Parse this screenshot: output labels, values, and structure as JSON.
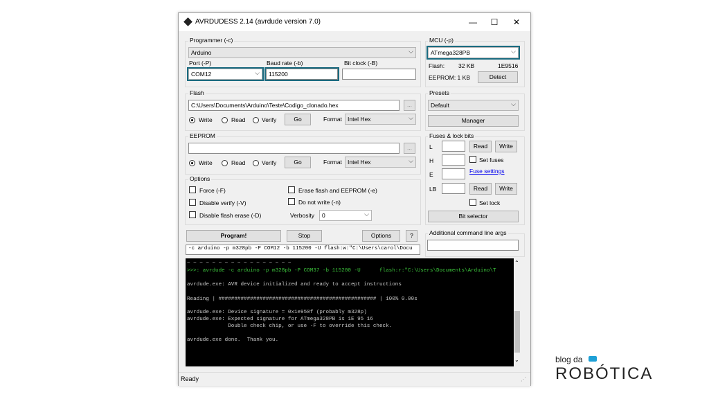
{
  "window": {
    "title": "AVRDUDESS 2.14 (avrdude version 7.0)",
    "minimize": "—",
    "maximize": "☐",
    "close": "✕"
  },
  "programmer": {
    "group_label": "Programmer (-c)",
    "value": "Arduino",
    "port_label": "Port (-P)",
    "port_value": "COM12",
    "baud_label": "Baud rate (-b)",
    "baud_value": "115200",
    "bitclock_label": "Bit clock (-B)",
    "bitclock_value": ""
  },
  "mcu": {
    "group_label": "MCU (-p)",
    "value": "ATmega328PB",
    "flash_label": "Flash:",
    "flash_size": "32 KB",
    "signature": "1E9516",
    "eeprom_label": "EEPROM: 1 KB",
    "detect": "Detect"
  },
  "flash": {
    "group_label": "Flash",
    "path": "C:\\Users\\Documents\\Arduino\\Teste\\Codigo_clonado.hex",
    "browse": "...",
    "write": "Write",
    "read": "Read",
    "verify": "Verify",
    "go": "Go",
    "format_label": "Format",
    "format_value": "Intel Hex"
  },
  "presets": {
    "group_label": "Presets",
    "value": "Default",
    "manager": "Manager"
  },
  "eeprom": {
    "group_label": "EEPROM",
    "path": "",
    "browse": "...",
    "write": "Write",
    "read": "Read",
    "verify": "Verify",
    "go": "Go",
    "format_label": "Format",
    "format_value": "Intel Hex"
  },
  "fuses": {
    "group_label": "Fuses & lock bits",
    "l": "L",
    "h": "H",
    "e": "E",
    "lb": "LB",
    "read": "Read",
    "write": "Write",
    "set_fuses": "Set fuses",
    "fuse_settings": "Fuse settings",
    "set_lock": "Set lock",
    "bit_selector": "Bit selector"
  },
  "options": {
    "group_label": "Options",
    "force": "Force (-F)",
    "erase": "Erase flash and EEPROM (-e)",
    "disable_verify": "Disable verify (-V)",
    "do_not_write": "Do not write (-n)",
    "disable_flash_erase": "Disable flash erase (-D)",
    "verbosity_label": "Verbosity",
    "verbosity_value": "0"
  },
  "actions": {
    "program": "Program!",
    "stop": "Stop",
    "options": "Options",
    "help": "?"
  },
  "additional": {
    "label": "Additional command line args",
    "value": ""
  },
  "command_line": "-c arduino -p m328pb -P COM12 -b 115200 -U flash:w:\"C:\\Users\\carol\\Docu",
  "console": [
    "~ ~ ~ ~ ~ ~ ~ ~ ~ ~ ~ ~ ~ ~ ~ ~ ~",
    ">>>: avrdude -c arduino -p m328pb -P COM37 -b 115200 -U      flash:r:\"C:\\Users\\Documents\\Arduino\\T",
    "avrdude.exe: AVR device initialized and ready to accept instructions",
    "Reading | ################################################## | 100% 0.00s",
    "avrdude.exe: Device signature = 0x1e950f (probably m328p)",
    "avrdude.exe: Expected signature for ATmega328PB is 1E 95 16",
    "             Double check chip, or use -F to override this check.",
    "avrdude.exe done.  Thank you."
  ],
  "status": "Ready",
  "brand": {
    "line1": "blog da",
    "line2": "ROBÓTICA"
  },
  "colors": {
    "highlight": "#1a6b80",
    "console_bg": "#000000",
    "command_green": "#3cc43c"
  }
}
